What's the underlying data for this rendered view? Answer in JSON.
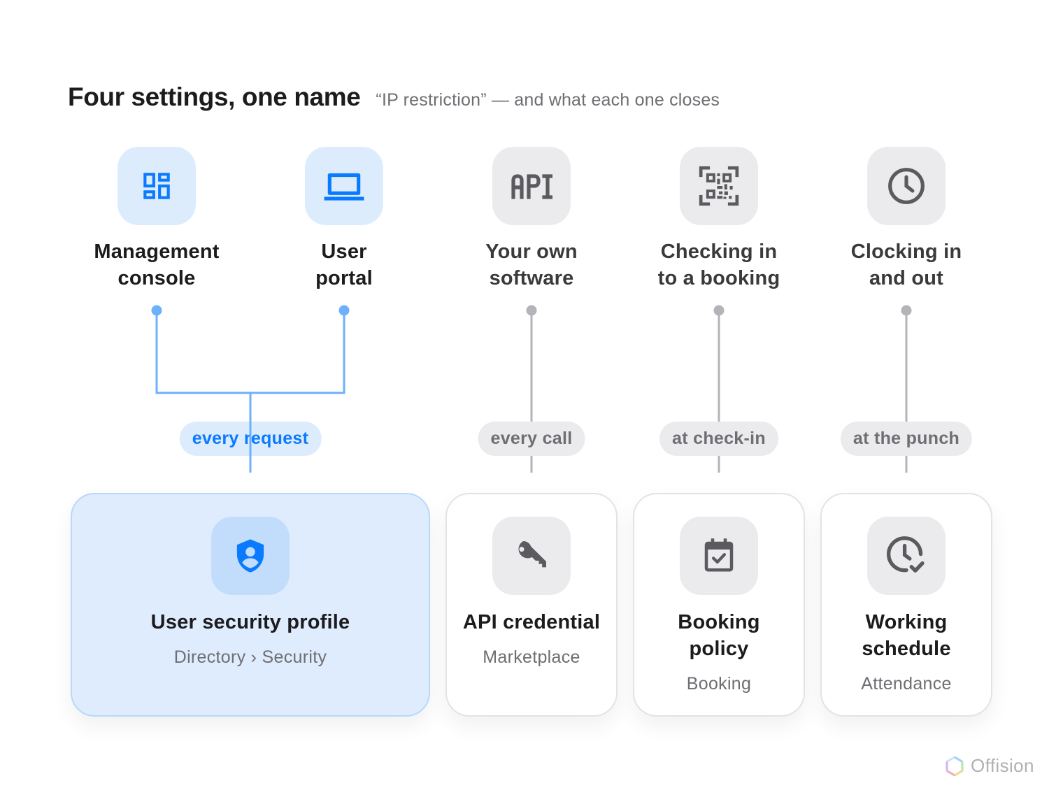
{
  "header": {
    "title": "Four settings, one name",
    "subtitle": "“IP restriction” — and what each one closes"
  },
  "sources": [
    {
      "line1": "Management",
      "line2": "console",
      "icon": "dashboard-icon",
      "group": "blue"
    },
    {
      "line1": "User",
      "line2": "portal",
      "icon": "laptop-icon",
      "group": "blue"
    },
    {
      "line1": "Your own",
      "line2": "software",
      "icon": "api-icon",
      "group": "gray"
    },
    {
      "line1": "Checking in",
      "line2": "to a booking",
      "icon": "qr-code-icon",
      "group": "gray"
    },
    {
      "line1": "Clocking in",
      "line2": "and out",
      "icon": "clock-icon",
      "group": "gray"
    }
  ],
  "pills": [
    "every request",
    "every call",
    "at check-in",
    "at the punch"
  ],
  "settings": [
    {
      "title": "User security profile",
      "module": "Directory › Security",
      "icon": "shield-user-icon"
    },
    {
      "title": "API credential",
      "module": "Marketplace",
      "icon": "key-icon"
    },
    {
      "line1": "Booking",
      "line2": "policy",
      "module": "Booking",
      "icon": "calendar-check-icon"
    },
    {
      "line1": "Working",
      "line2": "schedule",
      "module": "Attendance",
      "icon": "clock-check-icon"
    }
  ],
  "brand": {
    "name": "Offision"
  },
  "colors": {
    "accent": "#0a7aff",
    "accent_soft": "#dcecfd",
    "connector_blue": "#6cb1fb",
    "connector_gray": "#b3b3b8",
    "icon_gray": "#5a5a5f"
  }
}
